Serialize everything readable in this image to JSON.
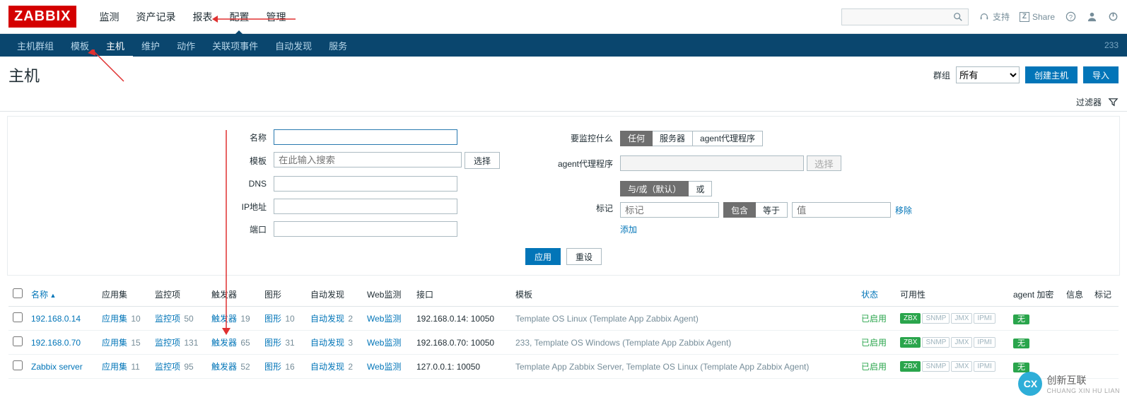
{
  "brand": "ZABBIX",
  "topnav": {
    "items": [
      "监测",
      "资产记录",
      "报表",
      "配置",
      "管理"
    ],
    "active": 3
  },
  "topright": {
    "support": "支持",
    "share": "Share"
  },
  "subnav": {
    "items": [
      "主机群组",
      "模板",
      "主机",
      "维护",
      "动作",
      "关联项事件",
      "自动发现",
      "服务"
    ],
    "active": 2,
    "count": "233"
  },
  "page": {
    "title": "主机",
    "group_label": "群组",
    "group_value": "所有",
    "create": "创建主机",
    "import": "导入"
  },
  "filterbar": {
    "label": "过滤器"
  },
  "filter": {
    "left_labels": {
      "name": "名称",
      "template": "模板",
      "dns": "DNS",
      "ip": "IP地址",
      "port": "端口"
    },
    "template_placeholder": "在此输入搜索",
    "select_btn": "选择",
    "right_labels": {
      "monitor": "要监控什么",
      "proxy": "agent代理程序",
      "tags": "标记"
    },
    "monitor_opts": [
      "任何",
      "服务器",
      "agent代理程序"
    ],
    "proxy_select": "选择",
    "tag_mode": [
      "与/或（默认）",
      "或"
    ],
    "tag_placeholder": "标记",
    "tag_op": [
      "包含",
      "等于"
    ],
    "val_placeholder": "值",
    "remove": "移除",
    "add": "添加",
    "apply": "应用",
    "reset": "重设"
  },
  "table": {
    "headers": {
      "name": "名称",
      "apps": "应用集",
      "items": "监控项",
      "triggers": "触发器",
      "graphs": "图形",
      "discovery": "自动发现",
      "web": "Web监测",
      "iface": "接口",
      "templates": "模板",
      "status": "状态",
      "avail": "可用性",
      "enc": "agent 加密",
      "info": "信息",
      "tags": "标记"
    },
    "avail_chips": [
      "ZBX",
      "SNMP",
      "JMX",
      "IPMI"
    ],
    "enc_no": "无",
    "status_enabled": "已启用",
    "rows": [
      {
        "name": "192.168.0.14",
        "apps": 10,
        "items": 50,
        "triggers": 19,
        "graphs": 10,
        "discovery": 2,
        "web": "Web监测",
        "iface": "192.168.0.14: 10050",
        "templates": "Template OS Linux (Template App Zabbix Agent)",
        "status": "已启用"
      },
      {
        "name": "192.168.0.70",
        "apps": 15,
        "items": 131,
        "triggers": 65,
        "graphs": 31,
        "discovery": 3,
        "web": "Web监测",
        "iface": "192.168.0.70: 10050",
        "templates": "233, Template OS Windows (Template App Zabbix Agent)",
        "status": "已启用"
      },
      {
        "name": "Zabbix server",
        "apps": 11,
        "items": 95,
        "triggers": 52,
        "graphs": 16,
        "discovery": 2,
        "web": "Web监测",
        "iface": "127.0.0.1: 10050",
        "templates": "Template App Zabbix Server, Template OS Linux (Template App Zabbix Agent)",
        "status": "已启用"
      }
    ]
  },
  "watermark": {
    "big": "创新互联",
    "small": "CHUANG XIN HU LIAN",
    "logo": "CX"
  }
}
